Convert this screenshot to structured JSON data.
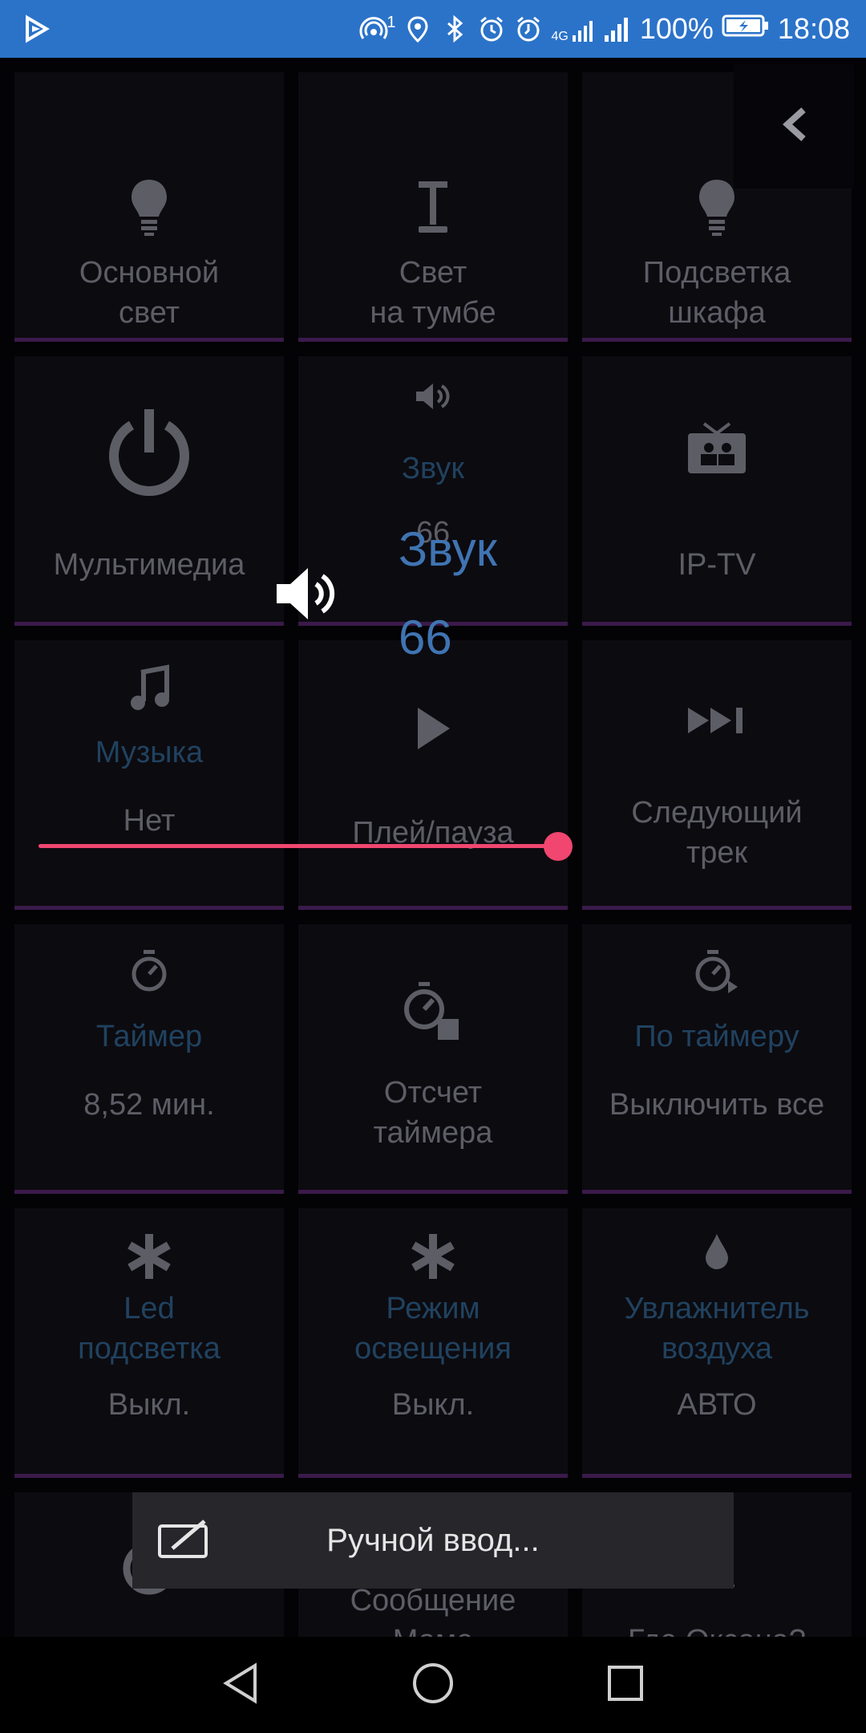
{
  "status_bar": {
    "battery": "100%",
    "time": "18:08",
    "signal_badge": "1",
    "network": "4G",
    "icons": [
      "play-store-icon",
      "hotspot-icon",
      "location-icon",
      "bluetooth-icon",
      "alarm-icon",
      "alarm-clock-icon",
      "mobile-data-icon",
      "signal-icon",
      "battery-charging-icon"
    ]
  },
  "tiles": [
    {
      "icon": "bulb-icon",
      "label": "Основной\nсвет",
      "value": ""
    },
    {
      "icon": "lamp-icon",
      "label": "Свет\nна тумбе",
      "value": ""
    },
    {
      "icon": "bulb-icon",
      "label": "Подсветка\nшкафа",
      "value": ""
    },
    {
      "icon": "power-icon",
      "label": "Мультимедиа",
      "value": ""
    },
    {
      "icon": "speaker-icon",
      "label": "Звук",
      "value": "66"
    },
    {
      "icon": "tv-icon",
      "label": "IP-TV",
      "value": ""
    },
    {
      "icon": "music-icon",
      "label": "Музыка",
      "value": "Нет"
    },
    {
      "icon": "play-icon",
      "label": "Плей/пауза",
      "value": ""
    },
    {
      "icon": "next-track-icon",
      "label": "Следующий\nтрек",
      "value": ""
    },
    {
      "icon": "timer-icon",
      "label": "Таймер",
      "value": "8,52 мин."
    },
    {
      "icon": "timer-countdown-icon",
      "label": "Отсчет\nтаймера",
      "value": ""
    },
    {
      "icon": "timer-schedule-icon",
      "label": "По таймеру",
      "value": "Выключить все"
    },
    {
      "icon": "asterisk-icon",
      "label": "Led\nподсветка",
      "value": "Выкл."
    },
    {
      "icon": "asterisk-icon",
      "label": "Режим\nосвещения",
      "value": "Выкл."
    },
    {
      "icon": "drop-icon",
      "label": "Увлажнитель\nвоздуха",
      "value": "АВТО"
    },
    {
      "icon": "block-icon",
      "label": "",
      "value": ""
    },
    {
      "icon": "gear-icon",
      "label": "Сообщение\nМаме",
      "value": ""
    },
    {
      "icon": "person-icon",
      "label": "Где Оксана?",
      "value": ""
    }
  ],
  "back_button": {
    "icon": "chevron-left-icon"
  },
  "volume": {
    "title": "Звук",
    "value": "66",
    "level": 66
  },
  "sheet": {
    "label": "Ручной ввод..."
  },
  "nav": {
    "back": "nav-back-icon",
    "home": "nav-home-icon",
    "recents": "nav-recents-icon"
  },
  "colors": {
    "status_bar": "#2b73c9",
    "accent": "#f0466f",
    "value_blue": "#3f74b2",
    "tile_bg": "#0c0b10",
    "tile_border": "#3a1a4a"
  }
}
